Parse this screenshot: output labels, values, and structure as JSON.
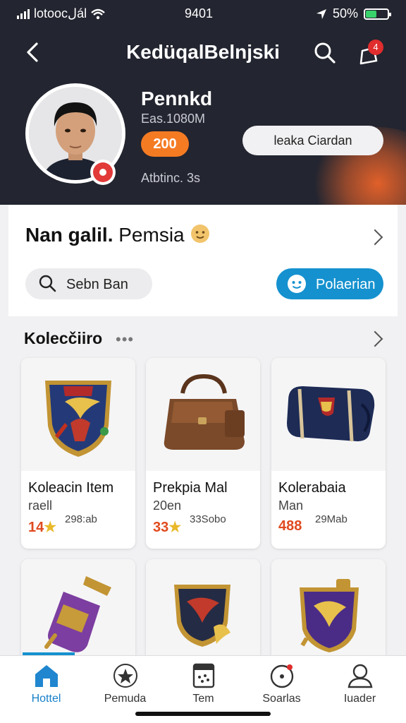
{
  "status_bar": {
    "carrier": "lotoocلál",
    "time": "9401",
    "battery_text": "50%",
    "battery_level": 0.5
  },
  "header": {
    "title": "KedüqalBelnjski"
  },
  "notifications": {
    "badge": "4"
  },
  "profile": {
    "name": "Pennkd",
    "subtitle": "Eas.1080M",
    "score": "200",
    "stat": "Atbtinc. 3s",
    "action_label": "leaka Ciardan"
  },
  "promo": {
    "title_bold": "Nan galil.",
    "title_rest": "Pemsia",
    "search_label": "Sebn Ban",
    "action_label": "Polaerian"
  },
  "collection": {
    "title": "Kolecčiiro",
    "items": [
      {
        "name": "Koleacin Item",
        "sub": "raell",
        "value": "14",
        "extra": "298:ab"
      },
      {
        "name": "Prekpia Mal",
        "sub": "20en",
        "value": "33",
        "extra": "33Sobo"
      },
      {
        "name": "Kolerabaia",
        "sub": "Man",
        "value": "488",
        "extra": "29Mab"
      },
      {
        "name": "",
        "sub": "",
        "value": "",
        "extra": ""
      },
      {
        "name": "",
        "sub": "",
        "value": "",
        "extra": ""
      },
      {
        "name": "",
        "sub": "",
        "value": "",
        "extra": ""
      }
    ]
  },
  "tabs": [
    {
      "label": "Hottel",
      "icon": "home-icon"
    },
    {
      "label": "Pemuda",
      "icon": "star-icon"
    },
    {
      "label": "Tem",
      "icon": "storage-icon"
    },
    {
      "label": "Soarlas",
      "icon": "compass-icon"
    },
    {
      "label": "Iuader",
      "icon": "profile-icon"
    }
  ],
  "colors": {
    "header_bg": "#232530",
    "accent_orange": "#f57b23",
    "accent_blue": "#1591cf",
    "value_red": "#e04a1f"
  }
}
